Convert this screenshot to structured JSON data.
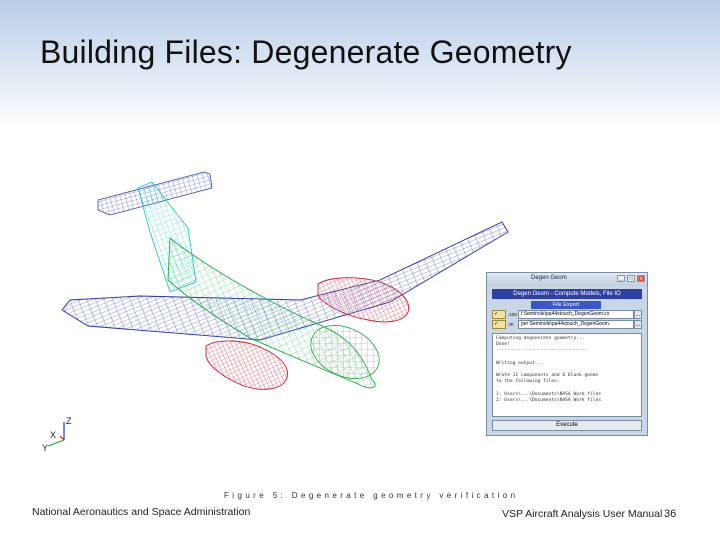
{
  "slide": {
    "title": "Building Files: Degenerate Geometry",
    "caption": "Figure 5: Degenerate geometry verification",
    "footer_left": "National Aeronautics and Space Administration",
    "footer_right": "VSP Aircraft Analysis User Manual",
    "page_number": "36"
  },
  "axes_triad": {
    "z": "Z",
    "x": "X",
    "y": "Y"
  },
  "dialog": {
    "window_title": "Degen Geom",
    "header": "Degen Geom - Compute Models, File IO",
    "section": "File Export",
    "rows": [
      {
        "ext": ".csv",
        "path": "f Seminole\\pa44stouch_DegenGeom.cs",
        "button": "..."
      },
      {
        "ext": ".m",
        "path": "per Seminole\\pa44stouch_DegenGeom.",
        "button": "..."
      }
    ],
    "log_lines": [
      "Computing degenerate geometry...",
      "Done!",
      "---------------------------------",
      "",
      "Writing output...",
      "",
      "Wrote 11 components and 6 blank geoms",
      "to the following files:",
      "",
      "    1: Users\\...\\Documents\\NASA Work files",
      "    2: Users\\...\\Documents\\NASA Work files"
    ],
    "execute_label": "Execute",
    "controls": {
      "minimize": "_",
      "maximize": "□",
      "close": "x"
    }
  },
  "colors": {
    "fuselage": "#33cc55",
    "tail": "#33dddd",
    "wing": "#3344cc",
    "nacelle": "#dd3344",
    "header_gradient": "#b9cde9"
  }
}
